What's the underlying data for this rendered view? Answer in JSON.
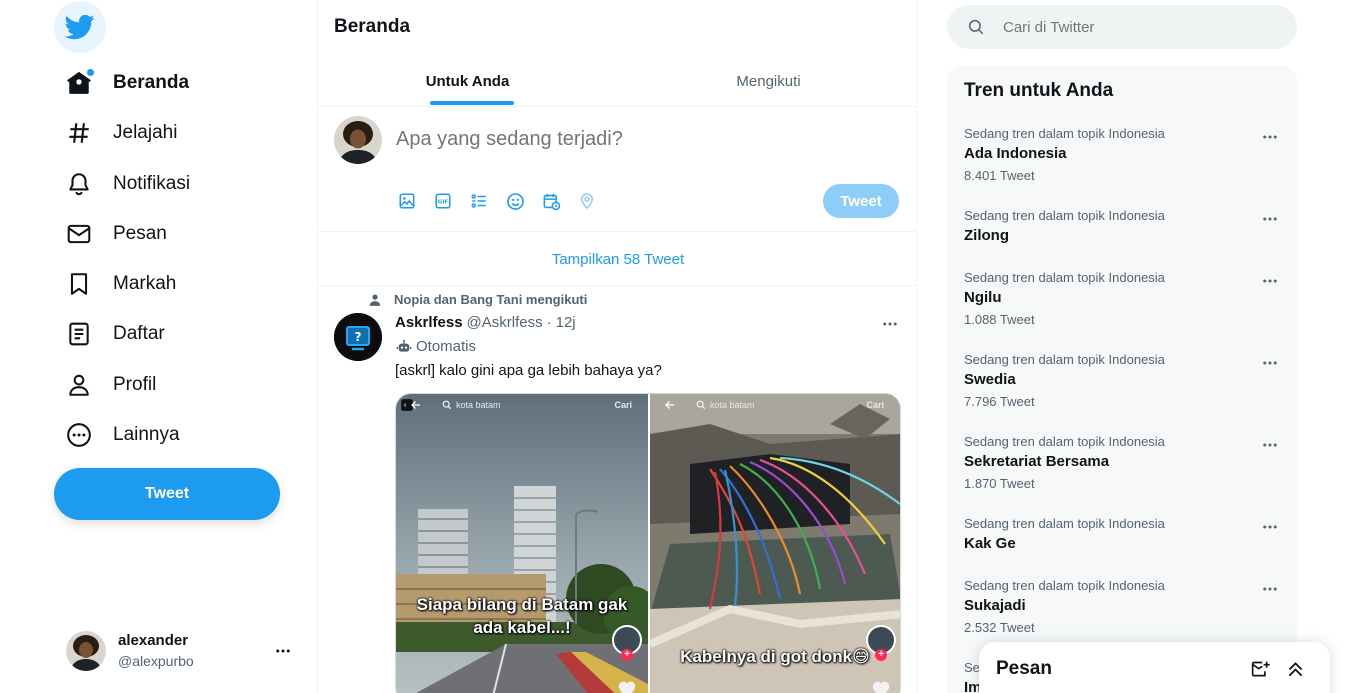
{
  "sidebar": {
    "nav": [
      {
        "label": "Beranda",
        "icon": "home-icon"
      },
      {
        "label": "Jelajahi",
        "icon": "hashtag-icon"
      },
      {
        "label": "Notifikasi",
        "icon": "bell-icon"
      },
      {
        "label": "Pesan",
        "icon": "mail-icon"
      },
      {
        "label": "Markah",
        "icon": "bookmark-icon"
      },
      {
        "label": "Daftar",
        "icon": "list-icon"
      },
      {
        "label": "Profil",
        "icon": "person-icon"
      },
      {
        "label": "Lainnya",
        "icon": "more-circle-icon"
      }
    ],
    "tweet_button": "Tweet",
    "account": {
      "name": "alexander",
      "handle": "@alexpurbo"
    }
  },
  "main": {
    "title": "Beranda",
    "tabs": [
      {
        "label": "Untuk Anda"
      },
      {
        "label": "Mengikuti"
      }
    ],
    "composer": {
      "placeholder": "Apa yang sedang terjadi?",
      "tweet_button": "Tweet"
    },
    "show_new": "Tampilkan 58 Tweet",
    "tweet": {
      "social_context": "Nopia dan Bang Tani mengikuti",
      "name": "Askrlfess",
      "handle": "@Askrlfess",
      "separator": "·",
      "time": "12j",
      "automated_label": "Otomatis",
      "text": "[askrl] kalo gini apa ga lebih bahaya ya?",
      "media": [
        {
          "search": "kota batam",
          "action": "Cari",
          "caption_line1": "Siapa bilang di Batam gak",
          "caption_line2": "ada kabel...!"
        },
        {
          "search": "kota batam",
          "action": "Cari",
          "caption_line1": "Kabelnya di got donk😅",
          "caption_line2": ""
        }
      ]
    }
  },
  "right": {
    "search_placeholder": "Cari di Twitter",
    "trends_title": "Tren untuk Anda",
    "trends": [
      {
        "category": "Sedang tren dalam topik Indonesia",
        "name": "Ada Indonesia",
        "count": "8.401 Tweet"
      },
      {
        "category": "Sedang tren dalam topik Indonesia",
        "name": "Zilong",
        "count": ""
      },
      {
        "category": "Sedang tren dalam topik Indonesia",
        "name": "Ngilu",
        "count": "1.088 Tweet"
      },
      {
        "category": "Sedang tren dalam topik Indonesia",
        "name": "Swedia",
        "count": "7.796 Tweet"
      },
      {
        "category": "Sedang tren dalam topik Indonesia",
        "name": "Sekretariat Bersama",
        "count": "1.870 Tweet"
      },
      {
        "category": "Sedang tren dalam topik Indonesia",
        "name": "Kak Ge",
        "count": ""
      },
      {
        "category": "Sedang tren dalam topik Indonesia",
        "name": "Sukajadi",
        "count": "2.532 Tweet"
      },
      {
        "category": "Se",
        "name": "Im",
        "count": ""
      }
    ],
    "messages_title": "Pesan"
  },
  "colors": {
    "accent": "#1d9bf0",
    "text": "#0f1419",
    "muted": "#536471",
    "disabled_button": "#8ecdf8"
  }
}
